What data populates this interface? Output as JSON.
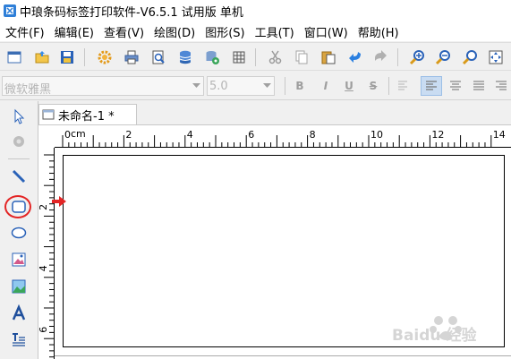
{
  "window": {
    "title": "中琅条码标签打印软件-V6.5.1 试用版 单机"
  },
  "menu": {
    "items": [
      "文件(F)",
      "编辑(E)",
      "查看(V)",
      "绘图(D)",
      "图形(S)",
      "工具(T)",
      "窗口(W)",
      "帮助(H)"
    ]
  },
  "format": {
    "font_value": "微软雅黑",
    "size_value": "5.0",
    "bold": "B",
    "italic": "I",
    "underline": "U",
    "strike": "S"
  },
  "document": {
    "tab_label": "未命名-1 *"
  },
  "ruler": {
    "unit": "cm",
    "h_labels": [
      "0",
      "2",
      "4",
      "6",
      "8",
      "10",
      "12",
      "14"
    ],
    "v_labels": [
      "2",
      "4",
      "6"
    ]
  },
  "colors": {
    "highlight": "#e32525",
    "accent": "#1e6fcf"
  },
  "watermark": "Baidu 经验"
}
